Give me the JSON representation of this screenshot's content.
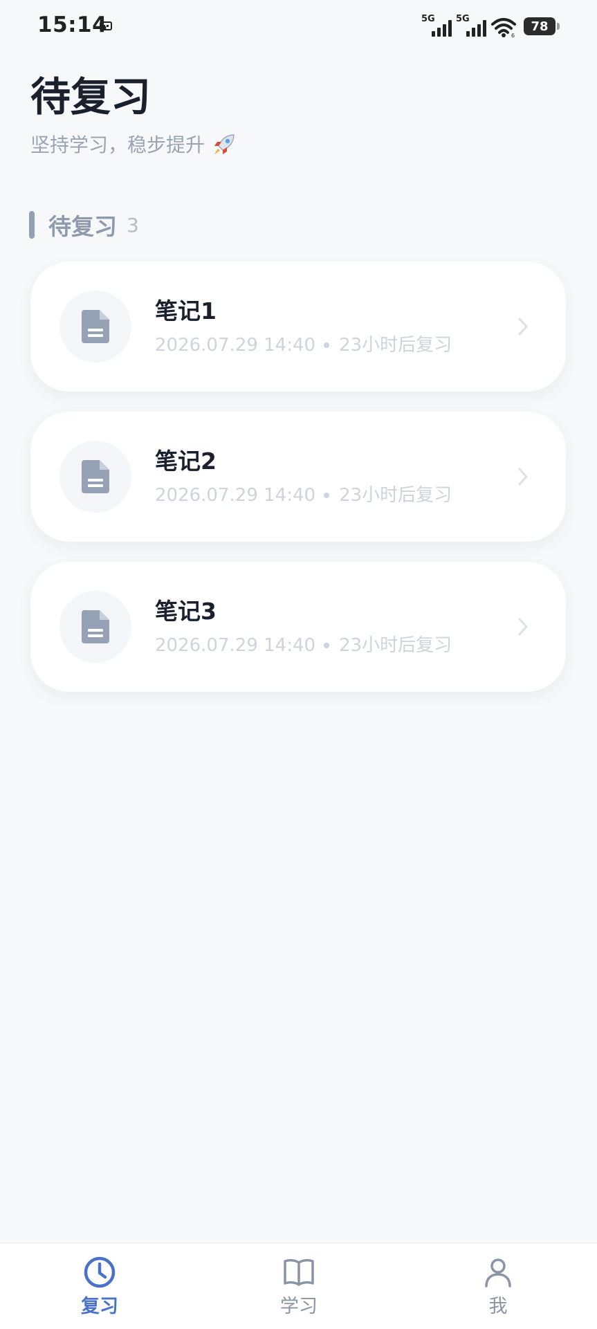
{
  "status_bar": {
    "time": "15:14",
    "network_1": "5G",
    "network_2": "5G",
    "battery": "78"
  },
  "header": {
    "title": "待复习",
    "subtitle": "坚持学习，稳步提升"
  },
  "section": {
    "title": "待复习",
    "count": "3"
  },
  "notes": [
    {
      "title": "笔记1",
      "date": "2026.07.29 14:40",
      "due": "23小时后复习"
    },
    {
      "title": "笔记2",
      "date": "2026.07.29 14:40",
      "due": "23小时后复习"
    },
    {
      "title": "笔记3",
      "date": "2026.07.29 14:40",
      "due": "23小时后复习"
    }
  ],
  "bottom_nav": {
    "items": [
      {
        "label": "复习",
        "icon": "clock-icon",
        "active": true
      },
      {
        "label": "学习",
        "icon": "book-icon",
        "active": false
      },
      {
        "label": "我",
        "icon": "user-icon",
        "active": false
      }
    ]
  },
  "colors": {
    "accent": "#4a72c9",
    "title": "#1a202c",
    "muted": "#9aa3b2",
    "background": "#f7f8fa"
  }
}
